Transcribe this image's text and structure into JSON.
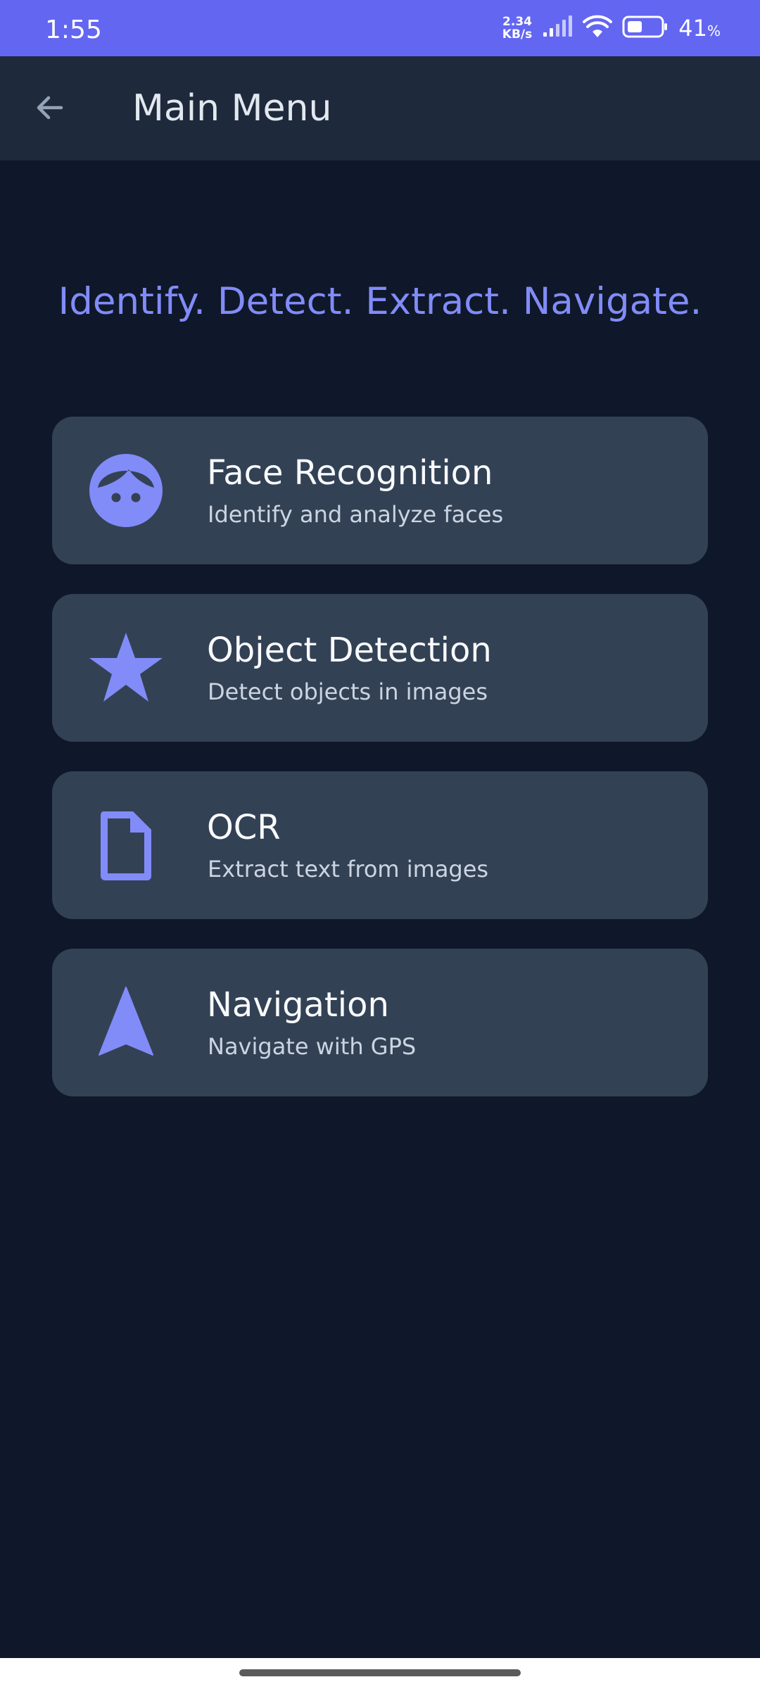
{
  "status_bar": {
    "time": "1:55",
    "net_speed_value": "2.34",
    "net_speed_unit": "KB/s",
    "battery_level": "41",
    "battery_unit": "%",
    "icons": [
      "signal-icon",
      "wifi-icon",
      "battery-icon"
    ]
  },
  "app_bar": {
    "title": "Main Menu",
    "back_icon": "arrow-back-icon"
  },
  "tagline": "Identify. Detect. Extract. Navigate.",
  "menu": {
    "items": [
      {
        "title": "Face Recognition",
        "subtitle": "Identify and analyze faces",
        "icon": "face-icon"
      },
      {
        "title": "Object Detection",
        "subtitle": "Detect objects in images",
        "icon": "star-icon"
      },
      {
        "title": "OCR",
        "subtitle": "Extract text from images",
        "icon": "document-icon"
      },
      {
        "title": "Navigation",
        "subtitle": "Navigate with GPS",
        "icon": "navigation-arrow-icon"
      }
    ]
  },
  "colors": {
    "accent": "#6366f1",
    "icon": "#818cf8",
    "background": "#0f172a",
    "surface": "#1e293b",
    "card": "#334155"
  }
}
